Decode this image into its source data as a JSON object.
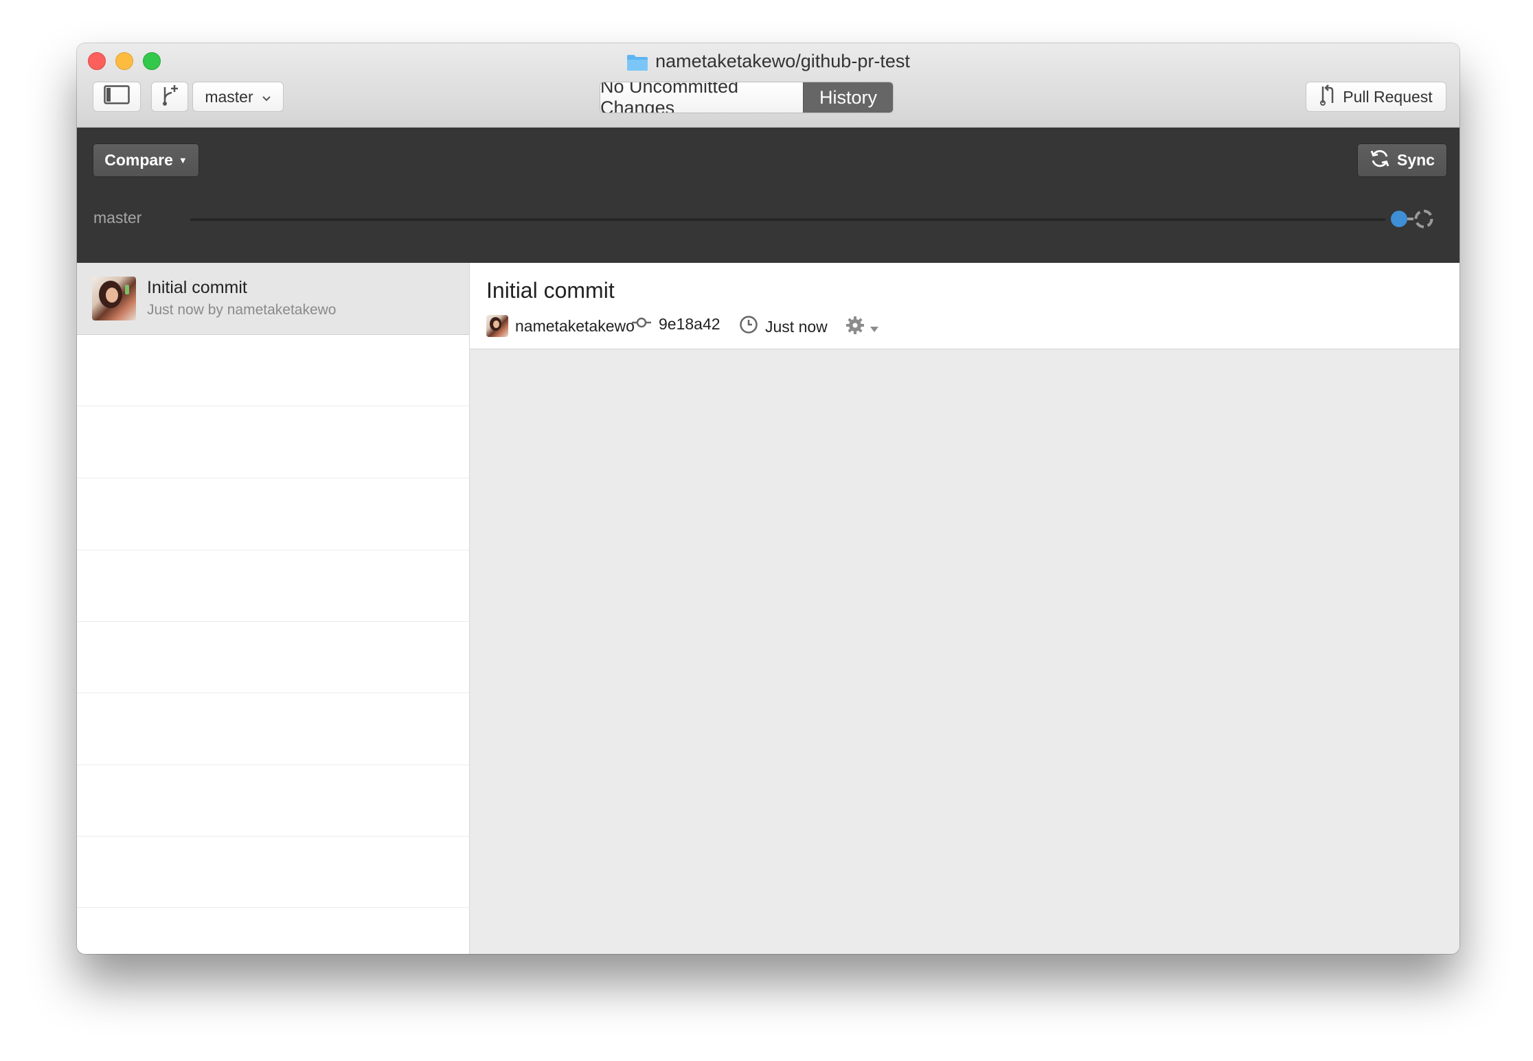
{
  "window": {
    "title": "nametaketakewo/github-pr-test"
  },
  "toolbar": {
    "branch_name": "master",
    "tab_changes": "No Uncommitted Changes",
    "tab_history": "History",
    "pull_request_label": "Pull Request"
  },
  "compare_panel": {
    "compare_label": "Compare",
    "sync_label": "Sync",
    "branch_label": "master"
  },
  "commit_list": {
    "items": [
      {
        "title": "Initial commit",
        "subtitle": "Just now by nametaketakewo"
      }
    ]
  },
  "commit_detail": {
    "title": "Initial commit",
    "author": "nametaketakewo",
    "sha": "9e18a42",
    "time": "Just now"
  },
  "colors": {
    "accent_blue": "#3e8fd6",
    "dark_panel": "#363636",
    "history_tab_bg": "#666666"
  }
}
